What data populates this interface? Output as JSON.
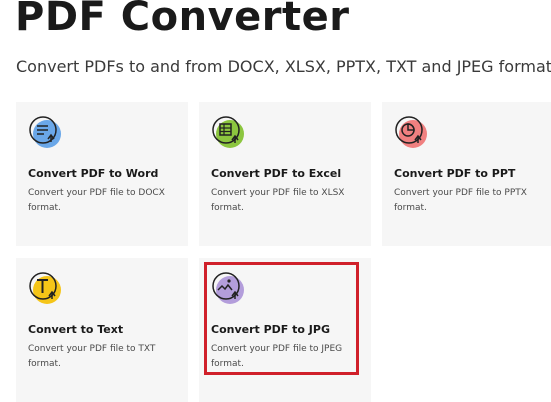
{
  "header": {
    "title": "PDF Converter",
    "subtitle": "Convert PDFs to and from DOCX, XLSX, PPTX, TXT and JPEG formats."
  },
  "cards": [
    {
      "title": "Convert PDF to Word",
      "description": "Convert your PDF file to DOCX format.",
      "icon": "word-doc-icon",
      "icon_color": "#6aa7e8"
    },
    {
      "title": "Convert PDF to Excel",
      "description": "Convert your PDF file to XLSX format.",
      "icon": "excel-sheet-icon",
      "icon_color": "#8cc63f"
    },
    {
      "title": "Convert PDF to PPT",
      "description": "Convert your PDF file to PPTX format.",
      "icon": "ppt-chart-icon",
      "icon_color": "#f08080"
    },
    {
      "title": "Convert to Text",
      "description": "Convert your PDF file to TXT format.",
      "icon": "text-t-icon",
      "icon_color": "#f5c518"
    },
    {
      "title": "Convert PDF to JPG",
      "description": "Convert your PDF file to JPEG format.",
      "icon": "image-icon",
      "icon_color": "#b39ddb"
    }
  ],
  "colors": {
    "card_background": "#f6f6f6",
    "highlight_border": "#d0202a"
  }
}
